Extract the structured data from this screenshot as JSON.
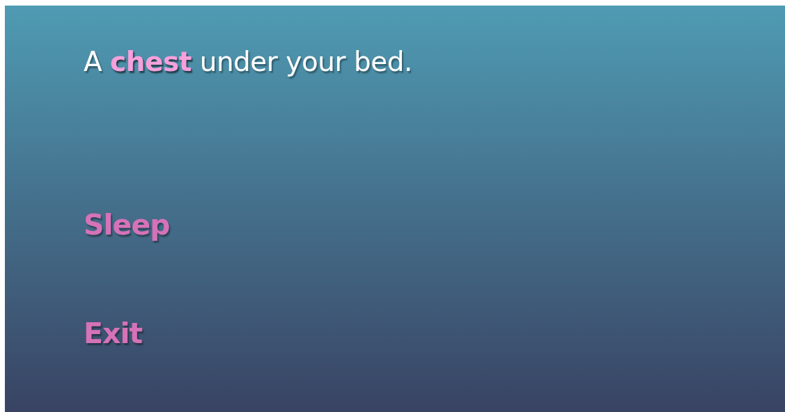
{
  "narration": "A **chest** under your bed.",
  "choices": [
    {
      "label": "Sleep"
    },
    {
      "label": "Exit"
    }
  ]
}
